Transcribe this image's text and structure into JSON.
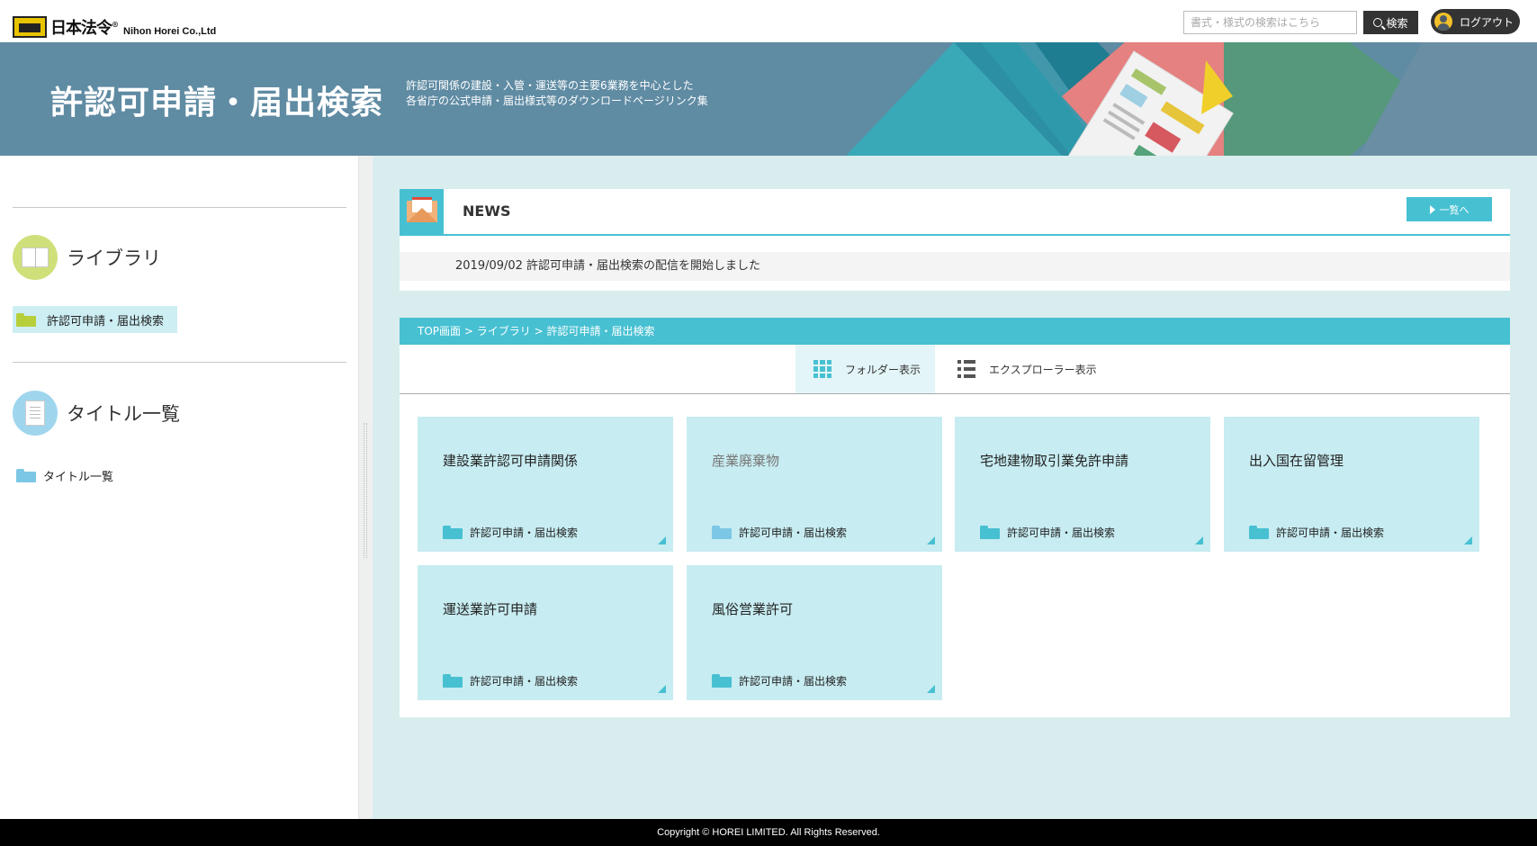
{
  "header": {
    "logo_jp": "日本法令",
    "logo_reg": "®",
    "logo_en": "Nihon Horei Co.,Ltd",
    "search_placeholder": "書式・様式の検索はこちら",
    "search_button": "検索",
    "logout_button": "ログアウト"
  },
  "banner": {
    "title": "許認可申請・届出検索",
    "subtitle_line1": "許認可関係の建設・入管・運送等の主要6業務を中心とした",
    "subtitle_line2": "各省庁の公式申請・届出様式等のダウンロードページリンク集"
  },
  "sidebar": {
    "library_heading": "ライブラリ",
    "library_item": "許認可申請・届出検索",
    "titles_heading": "タイトル一覧",
    "titles_item": "タイトル一覧"
  },
  "news": {
    "title": "NEWS",
    "more_button": "一覧へ",
    "items": [
      {
        "text": "2019/09/02 許認可申請・届出検索の配信を開始しました"
      }
    ]
  },
  "breadcrumb": {
    "items": [
      "TOP画面",
      "ライブラリ",
      "許認可申請・届出検索"
    ],
    "separator": ">"
  },
  "view_tabs": {
    "folder_view": "フォルダー表示",
    "explorer_view": "エクスプローラー表示",
    "active": "folder_view"
  },
  "cards": [
    {
      "title": "建設業許認可申請関係",
      "folder": "許認可申請・届出検索"
    },
    {
      "title": "産業廃棄物",
      "folder": "許認可申請・届出検索"
    },
    {
      "title": "宅地建物取引業免許申請",
      "folder": "許認可申請・届出検索"
    },
    {
      "title": "出入国在留管理",
      "folder": "許認可申請・届出検索"
    },
    {
      "title": "運送業許可申請",
      "folder": "許認可申請・届出検索"
    },
    {
      "title": "風俗営業許可",
      "folder": "許認可申請・届出検索"
    }
  ],
  "footer": {
    "copyright": "Copyright © HOREI LIMITED. All Rights Reserved."
  },
  "colors": {
    "accent": "#47c0d2",
    "banner": "#5f8ba3",
    "card_bg": "#c7ecf1",
    "main_bg": "#d9edee"
  }
}
